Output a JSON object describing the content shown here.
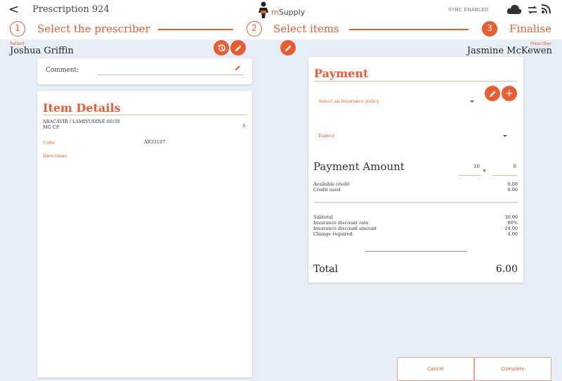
{
  "header": {
    "back_label": "<",
    "title": "Prescription 924",
    "logo": {
      "prefix": "m",
      "name": "Supply"
    },
    "sync_status": "SYNC ENABLED",
    "icons": [
      "cloud-icon",
      "sync-arrows-icon",
      "wifi-icon"
    ]
  },
  "steps": [
    {
      "number": "1",
      "label": "Select the prescriber"
    },
    {
      "number": "2",
      "label": "Select items"
    },
    {
      "number": "3",
      "label": "Finalise"
    }
  ],
  "patient": {
    "label": "Patient",
    "name": "Joshua Griffin"
  },
  "prescriber": {
    "label": "Prescriber",
    "name": "Jasmine McKewen"
  },
  "comment": {
    "label": "Comment:",
    "value": ""
  },
  "item_details": {
    "title": "Item Details",
    "item_name_line1": "ABACAVIR / LAMIVUDINE 60/30",
    "item_name_line2": "MG CP",
    "quantity": "3",
    "code_label": "Code",
    "code_value": "AR33197",
    "directions_label": "Directions"
  },
  "payment": {
    "title": "Payment",
    "insurance_placeholder": "Select an insurance policy",
    "payment_type": "Espèce",
    "amount_title": "Payment Amount",
    "amount_inputs": [
      "10",
      "0"
    ],
    "credit_labels": [
      "Available credit",
      "Credit used"
    ],
    "credit_values": [
      "0.00",
      "0.00"
    ],
    "summary_labels": [
      "Subtotal",
      "Insurance discount rate",
      "Insurance discount amount",
      "Change required"
    ],
    "summary_values": [
      "30.00",
      "80%",
      "24.00",
      "4.00"
    ],
    "total_label": "Total",
    "total_value": "6.00"
  },
  "actions": {
    "cancel": "Cancel",
    "complete": "Complete"
  },
  "colors": {
    "accent": "#e95c30",
    "background": "#e7eef8"
  }
}
